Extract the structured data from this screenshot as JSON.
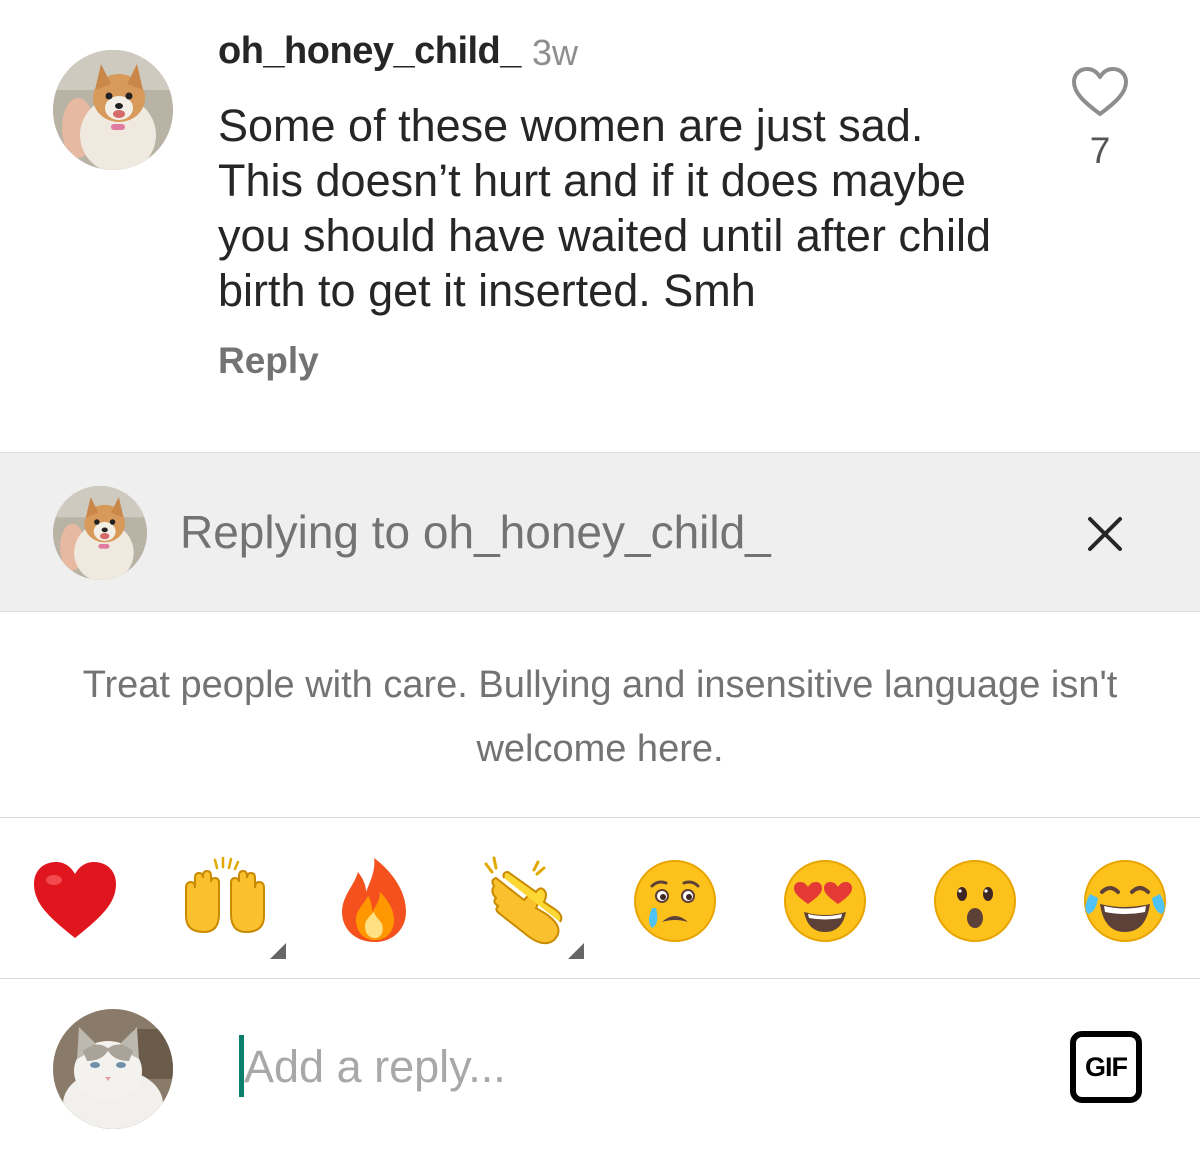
{
  "comment": {
    "username": "oh_honey_child_",
    "timestamp": "3w",
    "text": "Some of these women are just sad.\nThis doesn’t hurt and if it does maybe\nyou should have waited until after child\nbirth to get it inserted.  Smh",
    "reply_label": "Reply",
    "like_count": "7",
    "like_icon": "heart-outline-icon",
    "avatar": "dog-avatar"
  },
  "replying_bar": {
    "text": "Replying to oh_honey_child_",
    "close_icon": "close-icon",
    "avatar": "dog-avatar"
  },
  "notice": {
    "text": "Treat people with care. Bullying and insensitive language isn't welcome here."
  },
  "emoji_bar": {
    "items": [
      {
        "name": "red-heart",
        "has_variants": false
      },
      {
        "name": "raising-hands",
        "has_variants": true
      },
      {
        "name": "fire",
        "has_variants": false
      },
      {
        "name": "clapping-hands",
        "has_variants": true
      },
      {
        "name": "crying-face",
        "has_variants": false
      },
      {
        "name": "heart-eyes-face",
        "has_variants": false
      },
      {
        "name": "surprised-face",
        "has_variants": false
      },
      {
        "name": "tears-of-joy-face",
        "has_variants": false
      }
    ]
  },
  "composer": {
    "placeholder": "Add a reply...",
    "value": "",
    "gif_label": "GIF",
    "avatar": "cat-avatar"
  },
  "colors": {
    "text_primary": "#262626",
    "text_secondary": "#737373",
    "divider": "#dbdbdb",
    "replying_bg": "#efefef",
    "caret": "#0c7e6d"
  }
}
